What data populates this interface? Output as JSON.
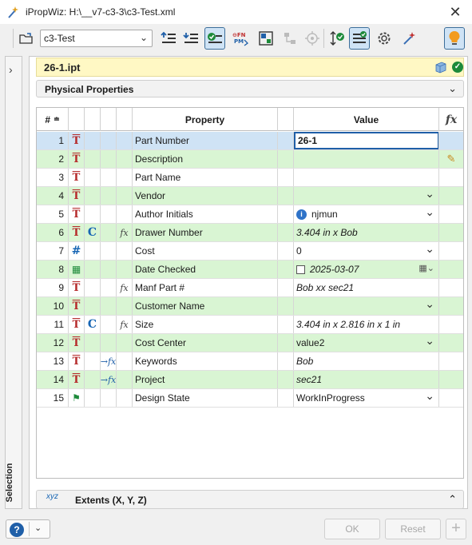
{
  "window": {
    "title": "iPropWiz: H:\\__v7-c3-3\\c3-Test.xml",
    "close_glyph": "✕"
  },
  "toolbar": {
    "config_select": "c3-Test",
    "icons": [
      "open-folder-icon",
      "indent-list-icon",
      "outdent-list-icon",
      "check-properties-icon",
      "find-replace-pm-icon",
      "layout-grid-icon",
      "hierarchy-icon",
      "zoom-target-icon",
      "mirror-check-icon",
      "checklist-icon",
      "settings-gear-icon",
      "magic-wand-icon",
      "lightbulb-icon"
    ]
  },
  "side_panel": {
    "label": "Selection",
    "expand_glyph": "›"
  },
  "file": {
    "name": "26-1.ipt"
  },
  "physical_section": {
    "title": "Physical Properties"
  },
  "grid": {
    "headers": {
      "num": "#",
      "property": "Property",
      "value": "Value",
      "fx": "fx"
    },
    "rows": [
      {
        "num": "1",
        "type": "text",
        "c": "",
        "link": "",
        "fx": "",
        "property": "Part Number",
        "value": "26-1",
        "editing": true
      },
      {
        "num": "2",
        "type": "text",
        "c": "",
        "link": "",
        "fx": "",
        "property": "Description",
        "value": "",
        "pencil": true
      },
      {
        "num": "3",
        "type": "text",
        "c": "",
        "link": "",
        "fx": "",
        "property": "Part Name",
        "value": ""
      },
      {
        "num": "4",
        "type": "text",
        "c": "",
        "link": "",
        "fx": "",
        "property": "Vendor",
        "value": "",
        "dropdown": true
      },
      {
        "num": "5",
        "type": "text",
        "c": "",
        "link": "",
        "fx": "",
        "property": "Author Initials",
        "value": "njmun",
        "dropdown": true,
        "info": true
      },
      {
        "num": "6",
        "type": "text",
        "c": "C",
        "link": "",
        "fx": "fx",
        "property": "Drawer Number",
        "value": "3.404 in x Bob",
        "italic": true
      },
      {
        "num": "7",
        "type": "number",
        "c": "",
        "link": "",
        "fx": "",
        "property": "Cost",
        "value": "0",
        "dropdown": true
      },
      {
        "num": "8",
        "type": "date",
        "c": "",
        "link": "",
        "fx": "",
        "property": "Date Checked",
        "value": "2025-03-07",
        "italic": true,
        "checkbox": true,
        "calendar": true
      },
      {
        "num": "9",
        "type": "text",
        "c": "",
        "link": "",
        "fx": "fx",
        "property": "Manf Part #",
        "value": "Bob xx sec21",
        "italic": true
      },
      {
        "num": "10",
        "type": "text",
        "c": "",
        "link": "",
        "fx": "",
        "property": "Customer Name",
        "value": "",
        "dropdown": true
      },
      {
        "num": "11",
        "type": "text",
        "c": "C",
        "link": "",
        "fx": "fx",
        "property": "Size",
        "value": "3.404 in x 2.816 in x 1 in",
        "italic": true
      },
      {
        "num": "12",
        "type": "text",
        "c": "",
        "link": "",
        "fx": "",
        "property": "Cost Center",
        "value": "value2",
        "dropdown": true
      },
      {
        "num": "13",
        "type": "text",
        "c": "",
        "link": "→fx",
        "fx": "",
        "property": "Keywords",
        "value": "Bob",
        "italic": true
      },
      {
        "num": "14",
        "type": "text",
        "c": "",
        "link": "→fx",
        "fx": "",
        "property": "Project",
        "value": "sec21",
        "italic": true
      },
      {
        "num": "15",
        "type": "state",
        "c": "",
        "link": "",
        "fx": "",
        "property": "Design State",
        "value": "WorkInProgress",
        "dropdown": true
      }
    ]
  },
  "extents_section": {
    "title": "Extents (X, Y, Z)",
    "icon_text": "xyz"
  },
  "footer": {
    "help_glyph": "?",
    "ok_label": "OK",
    "reset_label": "Reset",
    "plus_glyph": "+"
  }
}
